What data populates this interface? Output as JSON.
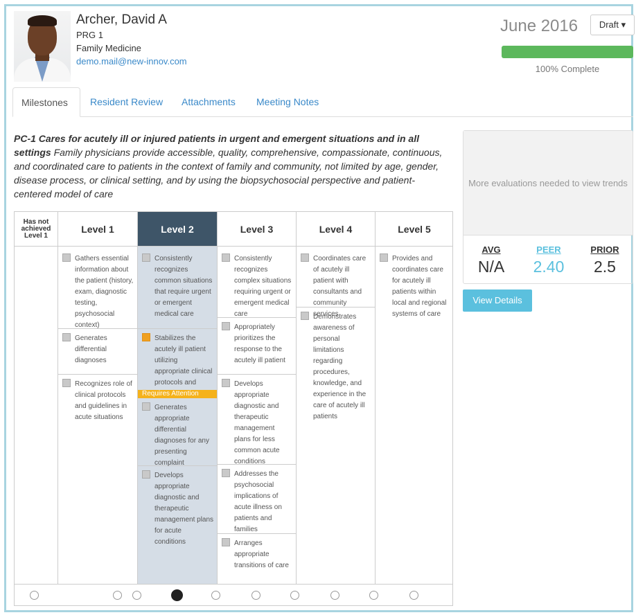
{
  "profile": {
    "name": "Archer, David A",
    "pgy": "PRG 1",
    "department": "Family Medicine",
    "email": "demo.mail@new-innov.com"
  },
  "status": {
    "month": "June 2016",
    "draft_label": "Draft",
    "progress": 1.0,
    "progress_label": "100% Complete"
  },
  "tabs": [
    "Milestones",
    "Resident Review",
    "Attachments",
    "Meeting Notes"
  ],
  "milestone": {
    "code": "PC-1 Cares for acutely ill or injured patients in urgent and emergent situations and in all settings",
    "description": "Family physicians provide accessible, quality, comprehensive, compassionate, continuous, and coordinated care to patients in the context of family and community, not limited by age, gender, disease process, or clinical setting, and by using the biopsychosocial perspective and patient-centered model of care"
  },
  "levels": {
    "not_achieved": "Has not achieved Level 1",
    "l1": "Level 1",
    "l2": "Level 2",
    "l3": "Level 3",
    "l4": "Level 4",
    "l5": "Level 5"
  },
  "items": {
    "l1": [
      "Gathers essential information about the patient (history, exam, diagnostic testing, psychosocial context)",
      "Generates differential diagnoses",
      "Recognizes role of clinical protocols and guidelines in acute situations"
    ],
    "l2": [
      "Consistently recognizes common situations that require urgent or emergent medical care",
      "Stabilizes the acutely ill patient utilizing appropriate clinical protocols and guidelines",
      "Generates appropriate differential diagnoses for any presenting complaint",
      "Develops appropriate diagnostic and therapeutic management plans for acute conditions"
    ],
    "l3": [
      "Consistently recognizes complex situations requiring urgent or emergent medical care",
      "Appropriately prioritizes the response to the acutely ill patient",
      "Develops appropriate diagnostic and therapeutic management plans for less common acute conditions",
      "Addresses the psychosocial implications of acute illness on patients and families",
      "Arranges appropriate transitions of care"
    ],
    "l4": [
      "Coordinates care of acutely ill patient with consultants and community services",
      "Demonstrates awareness of personal limitations regarding procedures, knowledge, and experience in the care of acutely ill patients"
    ],
    "l5": [
      "Provides and coordinates care for acutely ill patients within local and regional systems of care"
    ],
    "attention_label": "Requires Attention"
  },
  "selected_radio_index": 3,
  "trends": {
    "message": "More evaluations needed to view trends",
    "avg_label": "AVG",
    "avg_value": "N/A",
    "peer_label": "PEER",
    "peer_value": "2.40",
    "prior_label": "PRIOR",
    "prior_value": "2.5",
    "view_details": "View Details"
  },
  "colors": {
    "accent": "#3a89c9",
    "selected_header": "#3e5568",
    "selected_column": "#d5dde6",
    "progress": "#5cb85c",
    "attention": "#f5b21b",
    "peer": "#5bc0de"
  }
}
